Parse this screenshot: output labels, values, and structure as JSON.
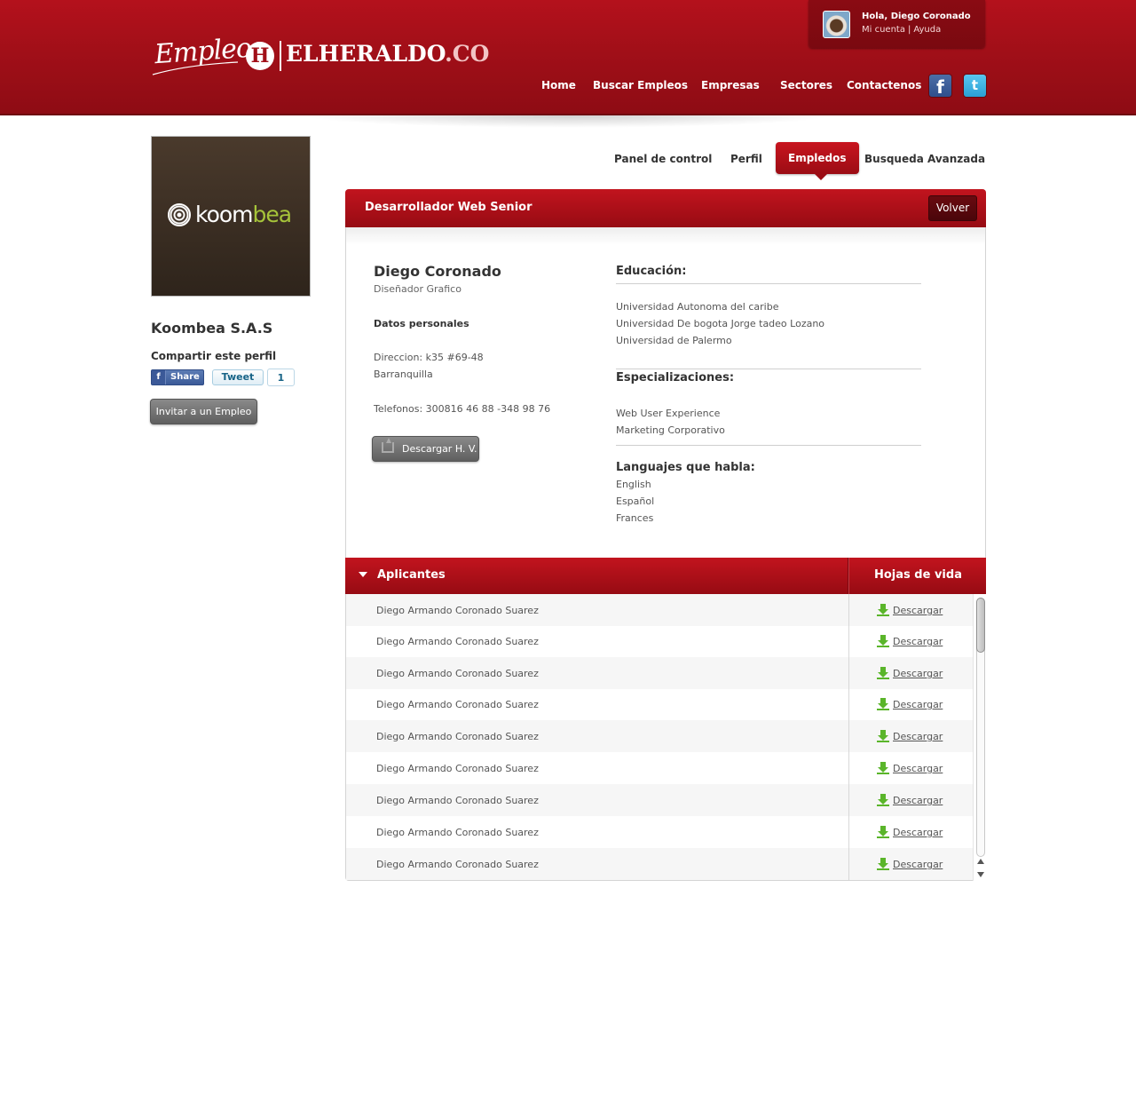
{
  "brand": {
    "logo_script": "Empleos",
    "logo_mark": "H",
    "logo_name": "ELHERALDO",
    "logo_tld": ".CO",
    "accent_color": "#a10f18"
  },
  "user": {
    "greeting": "Hola, Diego Coronado",
    "my_account": "Mi cuenta",
    "separator": "|",
    "help": "Ayuda"
  },
  "nav": {
    "items": [
      {
        "label": "Home"
      },
      {
        "label": "Buscar Empleos"
      },
      {
        "label": "Empresas"
      },
      {
        "label": "Sectores"
      },
      {
        "label": "Contactenos"
      }
    ],
    "social": [
      {
        "icon": "facebook-icon",
        "glyph": "f"
      },
      {
        "icon": "twitter-icon",
        "glyph": "t"
      }
    ]
  },
  "sidebar": {
    "company_logo_prefix": "koom",
    "company_logo_suffix": "bea",
    "company_name": "Koombea S.A.S",
    "share_label": "Compartir este perfil",
    "fb_share": "Share",
    "fb_glyph": "f",
    "tweet": "Tweet",
    "tweet_count": "1",
    "invite_button": "Invitar a un Empleo"
  },
  "tabs": [
    {
      "label": "Panel de control",
      "active": false
    },
    {
      "label": "Perfil",
      "active": false
    },
    {
      "label": "Empledos",
      "active": true
    },
    {
      "label": "Busqueda Avanzada",
      "active": false
    }
  ],
  "job": {
    "title": "Desarrollador Web Senior",
    "back_button": "Volver"
  },
  "candidate": {
    "name": "Diego Coronado",
    "role": "Diseñador Grafico",
    "personal_heading": "Datos personales",
    "address": "Direccion: k35 #69-48",
    "city": "Barranquilla",
    "phones": "Telefonos: 300816 46 88 -348 98 76",
    "download_cv": "Descargar H. V.",
    "education_heading": "Educación:",
    "education": [
      "Universidad Autonoma del caribe",
      "Universidad De bogota Jorge tadeo Lozano",
      "Universidad de Palermo"
    ],
    "specializations_heading": "Especializaciones:",
    "specializations": [
      "Web User Experience",
      "Marketing Corporativo"
    ],
    "languages_heading": "Languajes que habla:",
    "languages": [
      "English",
      "Español",
      "Frances"
    ]
  },
  "applicants": {
    "col_name": "Aplicantes",
    "col_cv": "Hojas de vida",
    "rows": [
      {
        "name": "Diego Armando Coronado Suarez",
        "action": "Descargar"
      },
      {
        "name": "Diego Armando Coronado Suarez",
        "action": "Descargar"
      },
      {
        "name": "Diego Armando Coronado Suarez",
        "action": "Descargar"
      },
      {
        "name": "Diego Armando Coronado Suarez",
        "action": "Descargar"
      },
      {
        "name": "Diego Armando Coronado Suarez",
        "action": "Descargar"
      },
      {
        "name": "Diego Armando Coronado Suarez",
        "action": "Descargar"
      },
      {
        "name": "Diego Armando Coronado Suarez",
        "action": "Descargar"
      },
      {
        "name": "Diego Armando Coronado Suarez",
        "action": "Descargar"
      },
      {
        "name": "Diego Armando Coronado Suarez",
        "action": "Descargar"
      }
    ]
  }
}
